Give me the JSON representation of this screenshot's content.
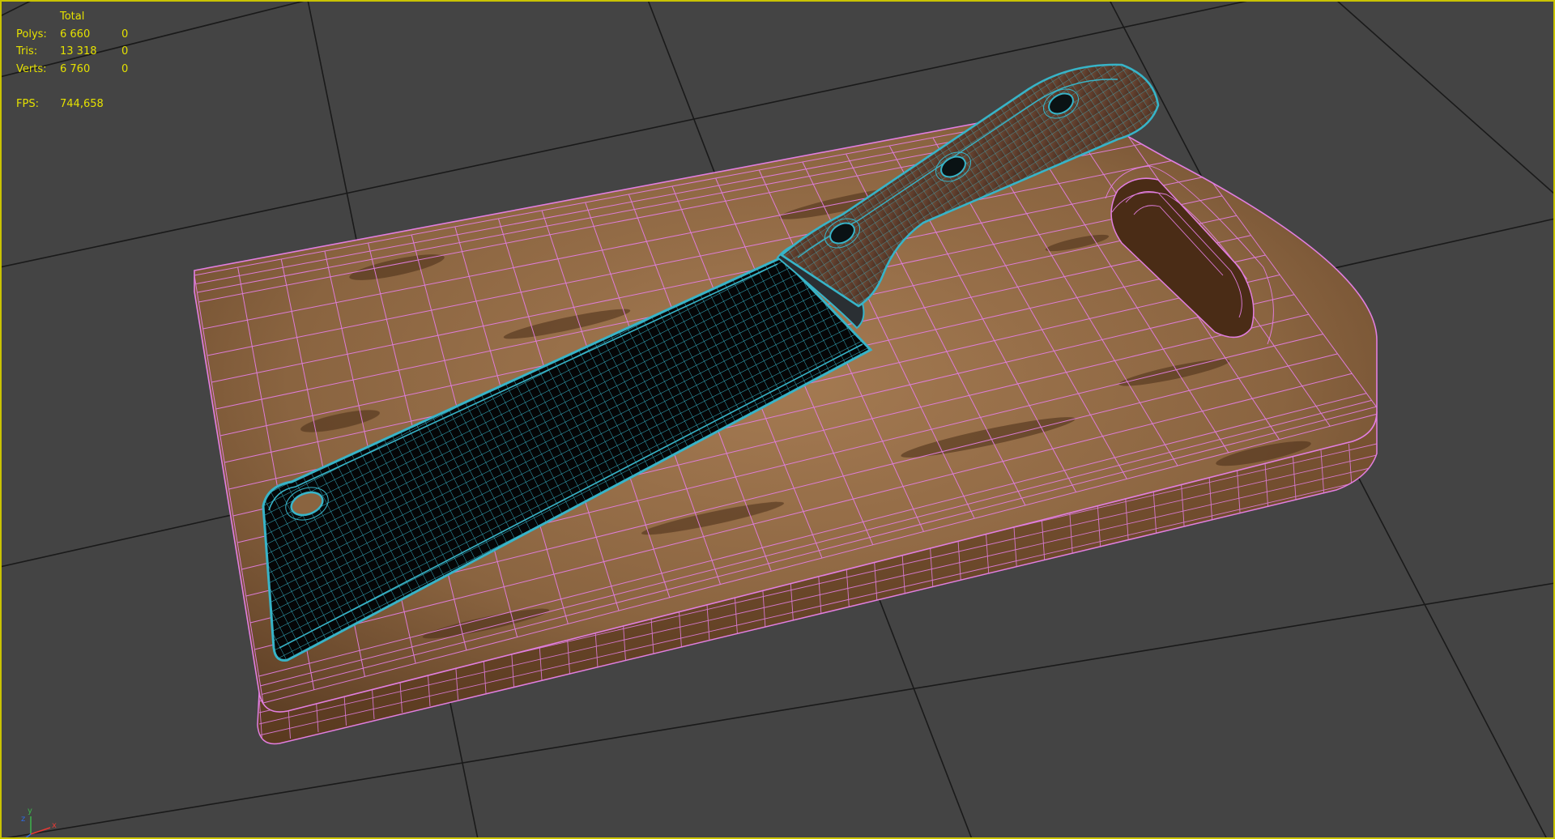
{
  "stats": {
    "header": "Total",
    "rows": [
      {
        "label": "Polys:",
        "total": "6 660",
        "selected": "0"
      },
      {
        "label": "Tris:",
        "total": "13 318",
        "selected": "0"
      },
      {
        "label": "Verts:",
        "total": "6 760",
        "selected": "0"
      }
    ],
    "fps_label": "FPS:",
    "fps_value": "744,658"
  },
  "gizmo": {
    "x": "x",
    "y": "y",
    "z": "z"
  },
  "colors": {
    "background": "#444444",
    "grid": "#1a1a1a",
    "stats_text": "#e5e100",
    "viewport_border": "#c9c300",
    "board_wire": "#e27ee0",
    "knife_wire": "#37b4c8",
    "wood": "#8a6440"
  },
  "icons": {
    "gizmo": "axis-tripod-icon"
  }
}
